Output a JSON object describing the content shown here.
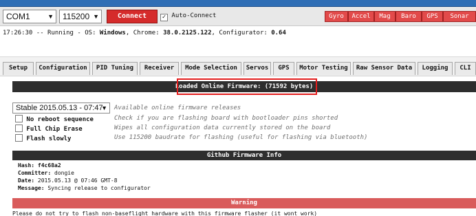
{
  "toolbar": {
    "port_value": "COM1",
    "baud_value": "115200",
    "connect_label": "Connect",
    "auto_connect_label": "Auto-Connect",
    "auto_connect_checked": true,
    "sensors": [
      "Gyro",
      "Accel",
      "Mag",
      "Baro",
      "GPS",
      "Sonar"
    ]
  },
  "log": {
    "time": "17:26:30",
    "sep": "--",
    "running": "Running - OS:",
    "os": "Windows",
    "chrome_label": ", Chrome:",
    "chrome_version": "38.0.2125.122",
    "configurator_label": ", Configurator:",
    "configurator_version": "0.64"
  },
  "tabs": [
    "Setup",
    "Configuration",
    "PID Tuning",
    "Receiver",
    "Mode Selection",
    "Servos",
    "GPS",
    "Motor Testing",
    "Raw Sensor Data",
    "Logging",
    "CLI"
  ],
  "firmware": {
    "loaded_label": "Loaded Online Firmware: (71592 bytes)",
    "release_select": "Stable 2015.05.13 - 07:47",
    "release_desc": "Available online firmware releases",
    "options": [
      {
        "label": "No reboot sequence",
        "desc": "Check if you are flashing board with bootloader pins shorted"
      },
      {
        "label": "Full Chip Erase",
        "desc": "Wipes all configuration data currently stored on the board"
      },
      {
        "label": "Flash slowly",
        "desc": "Use 115200 baudrate for flashing (useful for flashing via bluetooth)"
      }
    ]
  },
  "github": {
    "title": "Github Firmware Info",
    "hash_label": "Hash:",
    "hash_value": "f4c68a2",
    "committer_label": "Committer:",
    "committer_value": "dongie",
    "date_label": "Date:",
    "date_value": "2015.05.13 @ 07:46 GMT-8",
    "message_label": "Message:",
    "message_value": "Syncing release to configurator"
  },
  "warning": {
    "title": "Warning",
    "text": "Please do not try to flash non-baseflight hardware with this firmware flasher (it wont work)"
  },
  "colors": {
    "top_bar": "#2f6eb5",
    "connect_red": "#d52b2b",
    "sensor_red": "#e24a4a",
    "dark_bar": "#2e2e2e",
    "warning_bar": "#d95b5b",
    "highlight_outline": "#e31d1d"
  }
}
